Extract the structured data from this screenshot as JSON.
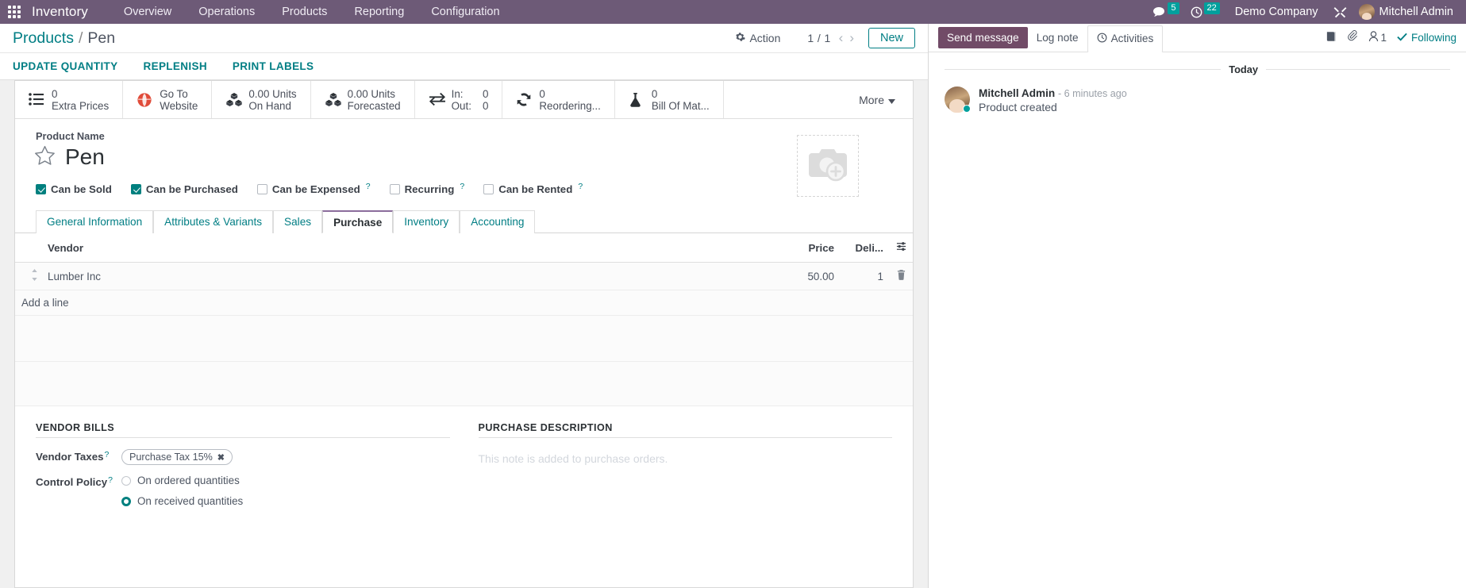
{
  "navbar": {
    "apps_icon": "apps-grid-icon",
    "brand": "Inventory",
    "menu": [
      "Overview",
      "Operations",
      "Products",
      "Reporting",
      "Configuration"
    ],
    "messages_icon": "comment-icon",
    "messages_count": "5",
    "activities_icon": "clock-icon",
    "activities_count": "22",
    "company": "Demo Company",
    "debug_icon": "tools-icon",
    "user": "Mitchell Admin"
  },
  "control_panel": {
    "breadcrumb_root": "Products",
    "breadcrumb_sep": "/",
    "breadcrumb_current": "Pen",
    "action_label": "Action",
    "action_icon": "gear-icon",
    "pager": "1 / 1",
    "prev_icon": "chevron-left-icon",
    "next_icon": "chevron-right-icon",
    "new_label": "New"
  },
  "button_bar": [
    "UPDATE QUANTITY",
    "REPLENISH",
    "PRINT LABELS"
  ],
  "smart_buttons": [
    {
      "icon": "list-icon",
      "line1": "0",
      "line2": "Extra Prices"
    },
    {
      "icon": "globe-icon",
      "line1": "Go To",
      "line2": "Website"
    },
    {
      "icon": "cubes-icon",
      "line1": "0.00 Units",
      "line2": "On Hand"
    },
    {
      "icon": "cubes-icon",
      "line1": "0.00 Units",
      "line2": "Forecasted"
    },
    {
      "icon": "exchange-icon",
      "in_label": "In:",
      "in_value": "0",
      "out_label": "Out:",
      "out_value": "0"
    },
    {
      "icon": "refresh-icon",
      "line1": "0",
      "line2": "Reordering..."
    },
    {
      "icon": "flask-icon",
      "line1": "0",
      "line2": "Bill Of Mat..."
    }
  ],
  "more_button": {
    "label": "More",
    "icon": "caret-down-icon"
  },
  "product": {
    "name_label": "Product Name",
    "name": "Pen",
    "star_icon": "star-outline-icon",
    "image_icon": "camera-add-icon",
    "checkboxes": [
      {
        "label": "Can be Sold",
        "checked": true,
        "help": false
      },
      {
        "label": "Can be Purchased",
        "checked": true,
        "help": false
      },
      {
        "label": "Can be Expensed",
        "checked": false,
        "help": true
      },
      {
        "label": "Recurring",
        "checked": false,
        "help": true
      },
      {
        "label": "Can be Rented",
        "checked": false,
        "help": true
      }
    ]
  },
  "tabs": [
    {
      "label": "General Information",
      "active": false
    },
    {
      "label": "Attributes & Variants",
      "active": false
    },
    {
      "label": "Sales",
      "active": false
    },
    {
      "label": "Purchase",
      "active": true
    },
    {
      "label": "Inventory",
      "active": false
    },
    {
      "label": "Accounting",
      "active": false
    }
  ],
  "vendor_list": {
    "columns": [
      "Vendor",
      "Price",
      "Deli..."
    ],
    "optional_icon": "column-settings-icon",
    "rows": [
      {
        "handle_icon": "drag-handle-icon",
        "vendor": "Lumber Inc",
        "price": "50.00",
        "delivery": "1",
        "delete_icon": "trash-icon"
      }
    ],
    "add_line": "Add a line"
  },
  "vendor_bills": {
    "title": "VENDOR BILLS",
    "vendor_taxes_label": "Vendor Taxes",
    "vendor_taxes_tag": "Purchase Tax 15%",
    "tag_remove_icon": "close-icon",
    "control_policy_label": "Control Policy",
    "control_policy_options": [
      {
        "label": "On ordered quantities",
        "selected": false
      },
      {
        "label": "On received quantities",
        "selected": true
      }
    ]
  },
  "purchase_description": {
    "title": "PURCHASE DESCRIPTION",
    "placeholder": "This note is added to purchase orders."
  },
  "chatter": {
    "send_message": "Send message",
    "log_note": "Log note",
    "activities": "Activities",
    "activities_icon": "clock-icon",
    "attachment_icon": "paperclip-icon",
    "log_icon": "book-icon",
    "followers_icon": "user-icon",
    "followers_count": "1",
    "following_label": "Following",
    "following_icon": "check-icon",
    "date_separator": "Today",
    "messages": [
      {
        "author": "Mitchell Admin",
        "time": "- 6 minutes ago",
        "body": "Product created"
      }
    ]
  },
  "colors": {
    "navbar": "#6d5a77",
    "primary": "#714b67",
    "teal": "#017e84",
    "badge": "#00A09D",
    "accent_tab": "#8b6d9c"
  }
}
